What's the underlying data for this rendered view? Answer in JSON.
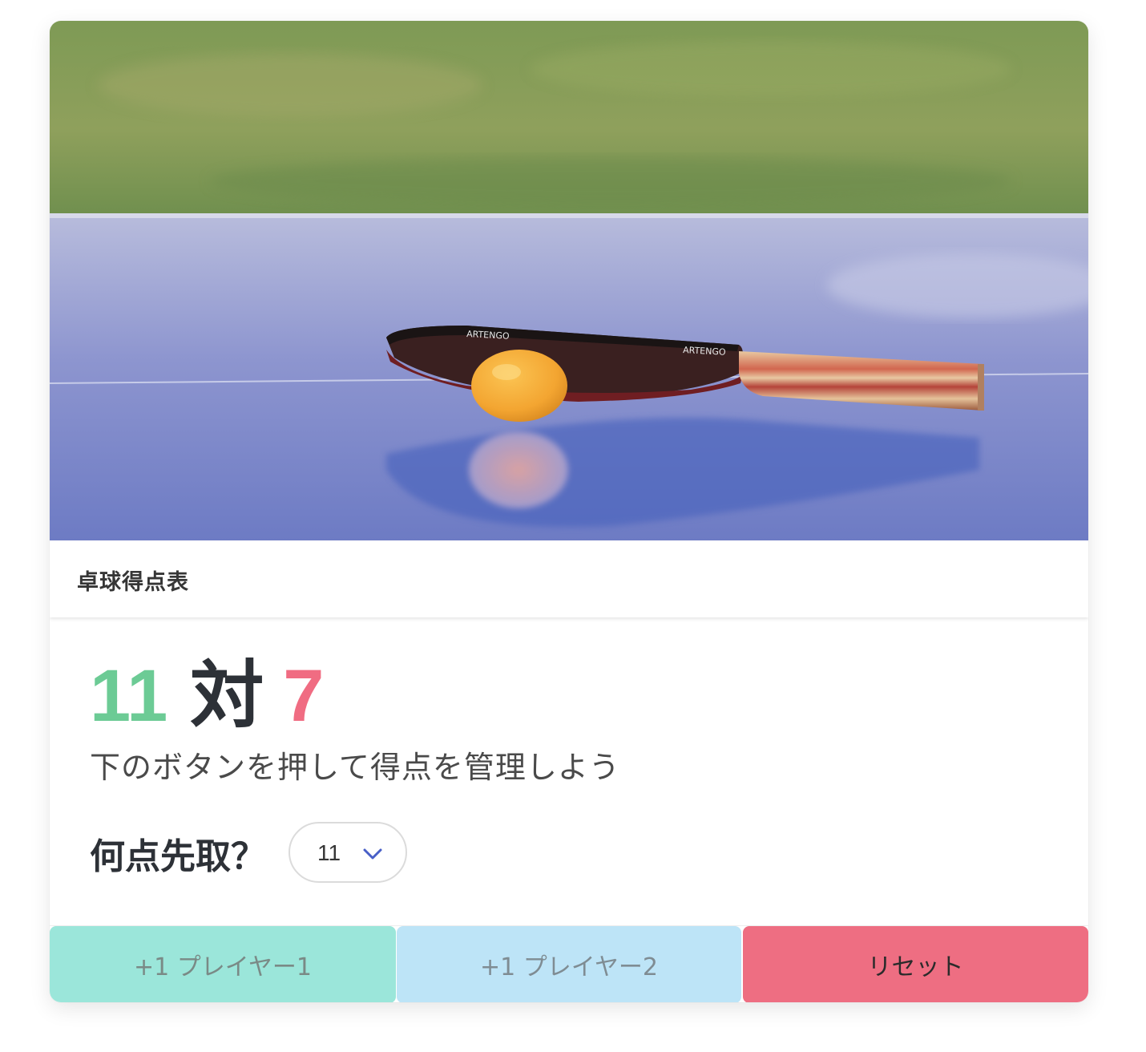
{
  "header": {
    "title": "卓球得点表"
  },
  "score": {
    "player1": "11",
    "separator": "対",
    "player2": "7"
  },
  "subtitle": "下のボタンを押して得点を管理しよう",
  "target": {
    "label": "何点先取？",
    "selected_value": "11"
  },
  "buttons": {
    "player1_label": "+1 プレイヤー1",
    "player2_label": "+1 プレイヤー2",
    "reset_label": "リセット"
  },
  "colors": {
    "player1": "#6ccb95",
    "player2": "#f06c82",
    "button_player1": "#9be6da",
    "button_player2": "#bde4f7",
    "button_reset": "#ee6e82"
  },
  "icons": {
    "select_arrow": "chevron-down-icon"
  }
}
